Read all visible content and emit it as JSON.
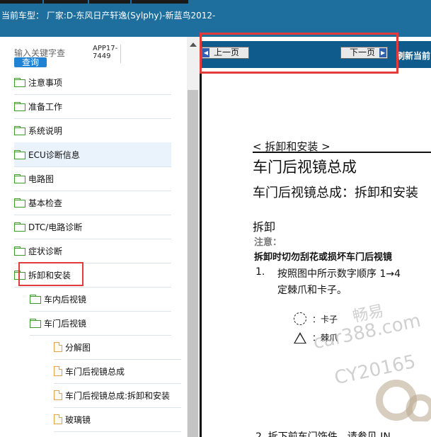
{
  "header": {
    "title": "当前车型： 厂家:D-东风日产轩逸(Sylphy)-新蓝鸟2012-"
  },
  "sidebar": {
    "search_placeholder": "输入关键字查",
    "search_button": "查询",
    "app_code": "APP17-7449",
    "items": [
      {
        "label": "注意事项",
        "icon": "folder-icon"
      },
      {
        "label": "准备工作",
        "icon": "folder-icon"
      },
      {
        "label": "系统说明",
        "icon": "folder-icon"
      },
      {
        "label": "ECU诊断信息",
        "icon": "folder-icon"
      },
      {
        "label": "电路图",
        "icon": "folder-icon"
      },
      {
        "label": "基本检查",
        "icon": "folder-icon"
      },
      {
        "label": "DTC/电路诊断",
        "icon": "folder-icon"
      },
      {
        "label": "症状诊断",
        "icon": "folder-icon"
      },
      {
        "label": "拆卸和安装",
        "icon": "folder-open-icon"
      },
      {
        "label": "车内后视镜",
        "icon": "folder-icon"
      },
      {
        "label": "车门后视镜",
        "icon": "folder-open-icon"
      },
      {
        "label": "分解图",
        "icon": "file-icon"
      },
      {
        "label": "车门后视镜总成",
        "icon": "file-icon"
      },
      {
        "label": "车门后视镜总成:拆卸和安装",
        "icon": "file-icon"
      },
      {
        "label": "玻璃镜",
        "icon": "file-icon"
      }
    ]
  },
  "nav": {
    "prev_label": "上一页",
    "next_label": "下一页",
    "refresh_label": "刷新当前"
  },
  "document": {
    "breadcrumb": "< 拆卸和安装 >",
    "title": "车门后视镜总成",
    "subtitle": "车门后视镜总成：拆卸和安装",
    "section": "拆卸",
    "note_label": "注意：",
    "warning": "拆卸时切勿刮花或损坏车门后视镜",
    "step1_number": "1.",
    "step1_text": "按照图中所示数字顺序 1→4",
    "step1_text_cont": "定棘爪和卡子。",
    "legend_clip": "：卡子",
    "legend_claw": "：棘爪",
    "step2_text": "2.    拆下前车门饰件，请参见 IN"
  },
  "watermark": {
    "line1": "畅易",
    "line2": "car388.com",
    "line3": "CY20165"
  },
  "colors": {
    "header_bg": "#1f6f9e",
    "nav_bg": "#0f5c8c",
    "highlight": "#e23b3b",
    "search_button_bg": "#1f82d2",
    "folder": "#3f9a2c",
    "file": "#e0a24a"
  }
}
